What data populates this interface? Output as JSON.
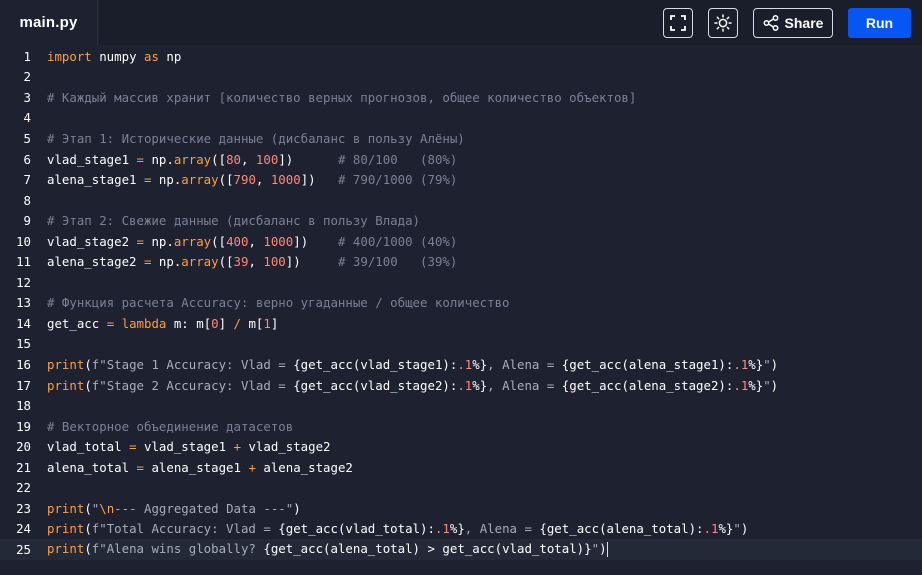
{
  "header": {
    "tab_title": "main.py",
    "share_label": "Share",
    "run_label": "Run",
    "icons": [
      "fullscreen-icon",
      "theme-toggle-icon",
      "share-icon"
    ]
  },
  "colors": {
    "background": "#1d2130",
    "run_button": "#0556f3",
    "keyword": "#ff9f43",
    "comment": "#7a8196",
    "number": "#ff8a78"
  },
  "editor": {
    "lines": [
      {
        "n": "1",
        "tokens": [
          [
            "kw",
            "import"
          ],
          [
            "pl",
            " numpy "
          ],
          [
            "kw",
            "as"
          ],
          [
            "pl",
            " np"
          ]
        ]
      },
      {
        "n": "2",
        "tokens": []
      },
      {
        "n": "3",
        "tokens": [
          [
            "cm",
            "# Каждый массив хранит [количество верных прогнозов, общее количество объектов]"
          ]
        ]
      },
      {
        "n": "4",
        "tokens": []
      },
      {
        "n": "5",
        "tokens": [
          [
            "cm",
            "# Этап 1: Исторические данные (дисбаланс в пользу Алёны)"
          ]
        ]
      },
      {
        "n": "6",
        "tokens": [
          [
            "pl",
            "vlad_stage1 "
          ],
          [
            "op",
            "="
          ],
          [
            "pl",
            " np."
          ],
          [
            "kw",
            "array"
          ],
          [
            "pl",
            "(["
          ],
          [
            "nm",
            "80"
          ],
          [
            "pl",
            ", "
          ],
          [
            "nm",
            "100"
          ],
          [
            "pl",
            "])      "
          ],
          [
            "cm",
            "# 80/100   (80%)"
          ]
        ]
      },
      {
        "n": "7",
        "tokens": [
          [
            "pl",
            "alena_stage1 "
          ],
          [
            "op",
            "="
          ],
          [
            "pl",
            " np."
          ],
          [
            "kw",
            "array"
          ],
          [
            "pl",
            "(["
          ],
          [
            "nm",
            "790"
          ],
          [
            "pl",
            ", "
          ],
          [
            "nm",
            "1000"
          ],
          [
            "pl",
            "])   "
          ],
          [
            "cm",
            "# 790/1000 (79%)"
          ]
        ]
      },
      {
        "n": "8",
        "tokens": []
      },
      {
        "n": "9",
        "tokens": [
          [
            "cm",
            "# Этап 2: Свежие данные (дисбаланс в пользу Влада)"
          ]
        ]
      },
      {
        "n": "10",
        "tokens": [
          [
            "pl",
            "vlad_stage2 "
          ],
          [
            "op",
            "="
          ],
          [
            "pl",
            " np."
          ],
          [
            "kw",
            "array"
          ],
          [
            "pl",
            "(["
          ],
          [
            "nm",
            "400"
          ],
          [
            "pl",
            ", "
          ],
          [
            "nm",
            "1000"
          ],
          [
            "pl",
            "])    "
          ],
          [
            "cm",
            "# 400/1000 (40%)"
          ]
        ]
      },
      {
        "n": "11",
        "tokens": [
          [
            "pl",
            "alena_stage2 "
          ],
          [
            "op",
            "="
          ],
          [
            "pl",
            " np."
          ],
          [
            "kw",
            "array"
          ],
          [
            "pl",
            "(["
          ],
          [
            "nm",
            "39"
          ],
          [
            "pl",
            ", "
          ],
          [
            "nm",
            "100"
          ],
          [
            "pl",
            "])     "
          ],
          [
            "cm",
            "# 39/100   (39%)"
          ]
        ]
      },
      {
        "n": "12",
        "tokens": []
      },
      {
        "n": "13",
        "tokens": [
          [
            "cm",
            "# Функция расчета Accuracy: верно угаданные / общее количество"
          ]
        ]
      },
      {
        "n": "14",
        "tokens": [
          [
            "pl",
            "get_acc "
          ],
          [
            "op",
            "="
          ],
          [
            "pl",
            " "
          ],
          [
            "kw",
            "lambda"
          ],
          [
            "pl",
            " m: m["
          ],
          [
            "nm",
            "0"
          ],
          [
            "pl",
            "] "
          ],
          [
            "op",
            "/"
          ],
          [
            "pl",
            " m["
          ],
          [
            "nm",
            "1"
          ],
          [
            "pl",
            "]"
          ]
        ]
      },
      {
        "n": "15",
        "tokens": []
      },
      {
        "n": "16",
        "tokens": [
          [
            "kw",
            "print"
          ],
          [
            "pl",
            "("
          ],
          [
            "st",
            "f\"Stage 1 Accuracy: Vlad = "
          ],
          [
            "pl",
            "{get_acc(vlad_stage1):"
          ],
          [
            "nm",
            ".1"
          ],
          [
            "pl",
            "%}"
          ],
          [
            "st",
            ", Alena = "
          ],
          [
            "pl",
            "{get_acc(alena_stage1):"
          ],
          [
            "nm",
            ".1"
          ],
          [
            "pl",
            "%}"
          ],
          [
            "st",
            "\""
          ],
          [
            "pl",
            ")"
          ]
        ]
      },
      {
        "n": "17",
        "tokens": [
          [
            "kw",
            "print"
          ],
          [
            "pl",
            "("
          ],
          [
            "st",
            "f\"Stage 2 Accuracy: Vlad = "
          ],
          [
            "pl",
            "{get_acc(vlad_stage2):"
          ],
          [
            "nm",
            ".1"
          ],
          [
            "pl",
            "%}"
          ],
          [
            "st",
            ", Alena = "
          ],
          [
            "pl",
            "{get_acc(alena_stage2):"
          ],
          [
            "nm",
            ".1"
          ],
          [
            "pl",
            "%}"
          ],
          [
            "st",
            "\""
          ],
          [
            "pl",
            ")"
          ]
        ]
      },
      {
        "n": "18",
        "tokens": []
      },
      {
        "n": "19",
        "tokens": [
          [
            "cm",
            "# Векторное объединение датасетов"
          ]
        ]
      },
      {
        "n": "20",
        "tokens": [
          [
            "pl",
            "vlad_total "
          ],
          [
            "op",
            "="
          ],
          [
            "pl",
            " vlad_stage1 "
          ],
          [
            "op",
            "+"
          ],
          [
            "pl",
            " vlad_stage2"
          ]
        ]
      },
      {
        "n": "21",
        "tokens": [
          [
            "pl",
            "alena_total "
          ],
          [
            "op",
            "="
          ],
          [
            "pl",
            " alena_stage1 "
          ],
          [
            "op",
            "+"
          ],
          [
            "pl",
            " alena_stage2"
          ]
        ]
      },
      {
        "n": "22",
        "tokens": []
      },
      {
        "n": "23",
        "tokens": [
          [
            "kw",
            "print"
          ],
          [
            "pl",
            "("
          ],
          [
            "st",
            "\""
          ],
          [
            "kw",
            "\\n"
          ],
          [
            "st",
            "--- Aggregated Data ---\""
          ],
          [
            "pl",
            ")"
          ]
        ]
      },
      {
        "n": "24",
        "tokens": [
          [
            "kw",
            "print"
          ],
          [
            "pl",
            "("
          ],
          [
            "st",
            "f\"Total Accuracy: Vlad = "
          ],
          [
            "pl",
            "{get_acc(vlad_total):"
          ],
          [
            "nm",
            ".1"
          ],
          [
            "pl",
            "%}"
          ],
          [
            "st",
            ", Alena = "
          ],
          [
            "pl",
            "{get_acc(alena_total):"
          ],
          [
            "nm",
            ".1"
          ],
          [
            "pl",
            "%}"
          ],
          [
            "st",
            "\""
          ],
          [
            "pl",
            ")"
          ]
        ]
      },
      {
        "n": "25",
        "tokens": [
          [
            "kw",
            "print"
          ],
          [
            "pl",
            "("
          ],
          [
            "st",
            "f\"Alena wins globally? "
          ],
          [
            "pl",
            "{get_acc(alena_total) > get_acc(vlad_total)}"
          ],
          [
            "st",
            "\""
          ],
          [
            "pl",
            ")"
          ]
        ],
        "active": true
      }
    ]
  }
}
